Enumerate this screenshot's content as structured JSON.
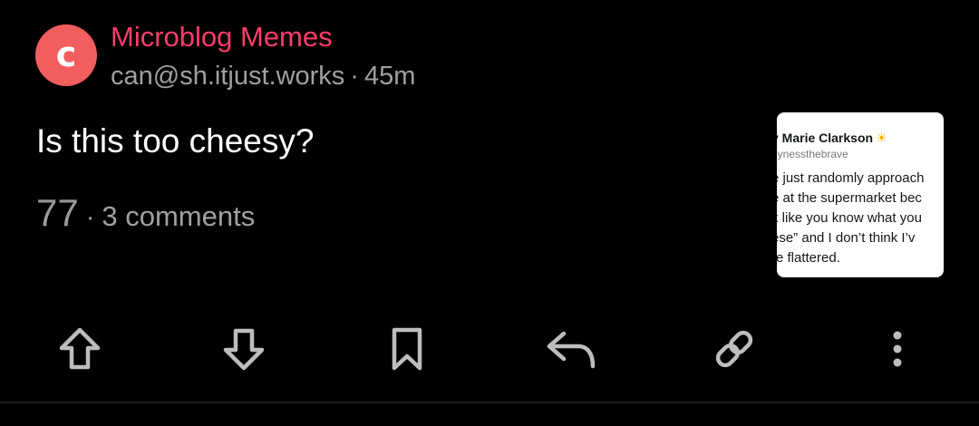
{
  "post": {
    "community": {
      "name": "Microblog Memes",
      "avatar_letter": "c",
      "avatar_color": "#f25d5d",
      "name_color": "#ff3d6b"
    },
    "author": "can@sh.itjust.works",
    "separator": "·",
    "age": "45m",
    "title": "Is this too cheesy?",
    "score": "77",
    "comments": "3 comments",
    "thumbnail": {
      "name": "y Marie Clarkson",
      "badge": "☀",
      "handle": "bynessthebrave",
      "lines": [
        "e just randomly approach",
        "e at the supermarket bec",
        "k like you know what you",
        "ese” and I don’t think I’v",
        "re flattered."
      ]
    }
  },
  "actions": {
    "upvote": "arrow-up-icon",
    "downvote": "arrow-down-icon",
    "save": "bookmark-icon",
    "reply": "reply-icon",
    "share": "link-icon",
    "more": "more-vertical-icon"
  },
  "colors": {
    "background": "#000000",
    "icon": "#bdbdbd",
    "muted_text": "#a0a0a0"
  }
}
